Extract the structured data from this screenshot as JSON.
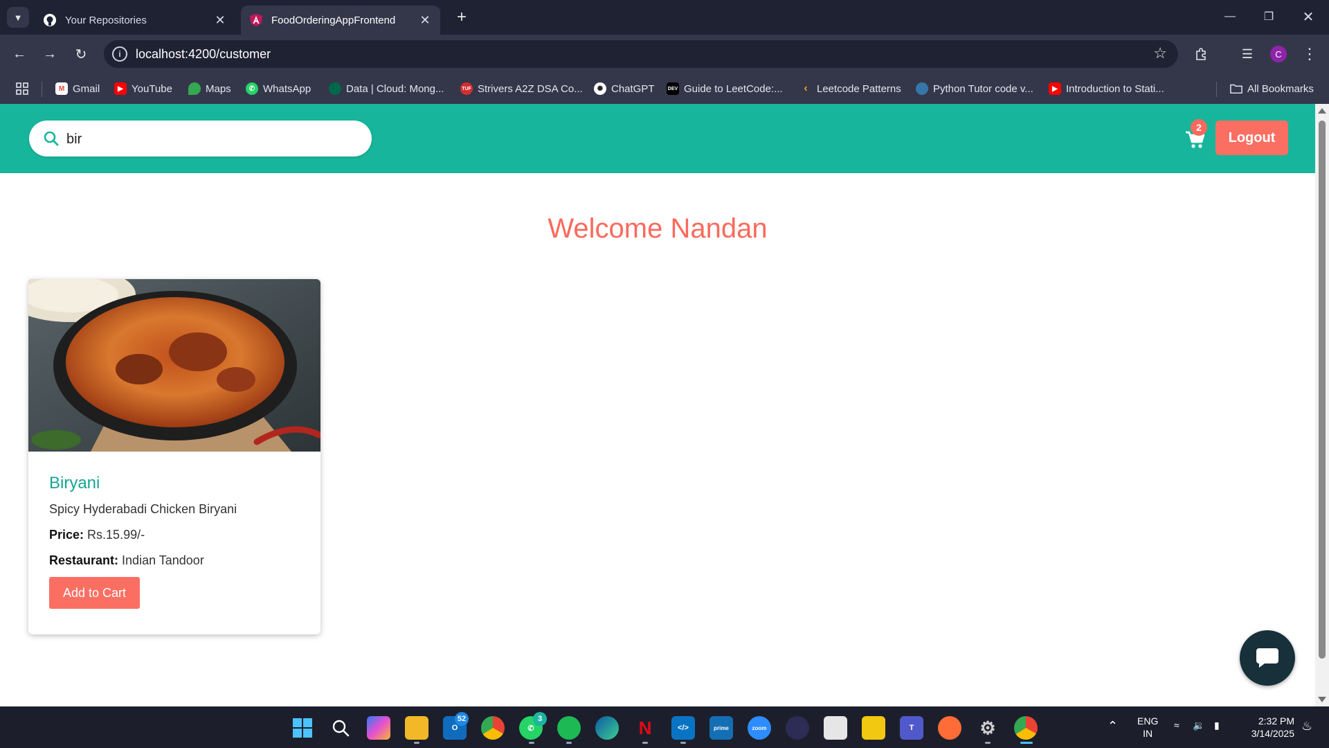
{
  "browser": {
    "tabs": [
      {
        "title": "Your Repositories",
        "active": false,
        "icon": "github-icon"
      },
      {
        "title": "FoodOrderingAppFrontend",
        "active": true,
        "icon": "angular-icon"
      }
    ],
    "url": "localhost:4200/customer",
    "profile_initial": "C",
    "bookmarks": [
      {
        "label": "Gmail",
        "icon": "gmail-icon",
        "color": "#ea4335"
      },
      {
        "label": "YouTube",
        "icon": "youtube-icon",
        "color": "#ff0000"
      },
      {
        "label": "Maps",
        "icon": "maps-icon",
        "color": "#34a853"
      },
      {
        "label": "WhatsApp",
        "icon": "whatsapp-icon",
        "color": "#25d366"
      },
      {
        "label": "Data | Cloud: Mong...",
        "icon": "mongodb-icon",
        "color": "#00684a"
      },
      {
        "label": "Strivers A2Z DSA Co...",
        "icon": "tuf-icon",
        "color": "#d32f2f"
      },
      {
        "label": "ChatGPT",
        "icon": "chatgpt-icon",
        "color": "#ffffff"
      },
      {
        "label": "Guide to LeetCode:...",
        "icon": "dev-icon",
        "color": "#000000"
      },
      {
        "label": "Leetcode Patterns",
        "icon": "leetcode-icon",
        "color": "#f0a41d"
      },
      {
        "label": "Python Tutor code v...",
        "icon": "python-icon",
        "color": "#3776ab"
      },
      {
        "label": "Introduction to Stati...",
        "icon": "youtube-icon",
        "color": "#ff0000"
      }
    ],
    "all_bookmarks": "All Bookmarks"
  },
  "app": {
    "search": {
      "value": "bir",
      "placeholder": "Search"
    },
    "cart_count": "2",
    "logout_label": "Logout",
    "welcome": "Welcome Nandan",
    "accent": "#17b59c",
    "brand_red": "#fb6f63",
    "items": [
      {
        "name": "Biryani",
        "description": "Spicy Hyderabadi Chicken Biryani",
        "price_label": "Price:",
        "price": "Rs.15.99/-",
        "restaurant_label": "Restaurant:",
        "restaurant": "Indian Tandoor",
        "button": "Add to Cart"
      }
    ]
  },
  "taskbar": {
    "badges": {
      "outlook": "52",
      "whatsapp": "3"
    },
    "lang_line1": "ENG",
    "lang_line2": "IN",
    "time": "2:32 PM",
    "date": "3/14/2025"
  }
}
